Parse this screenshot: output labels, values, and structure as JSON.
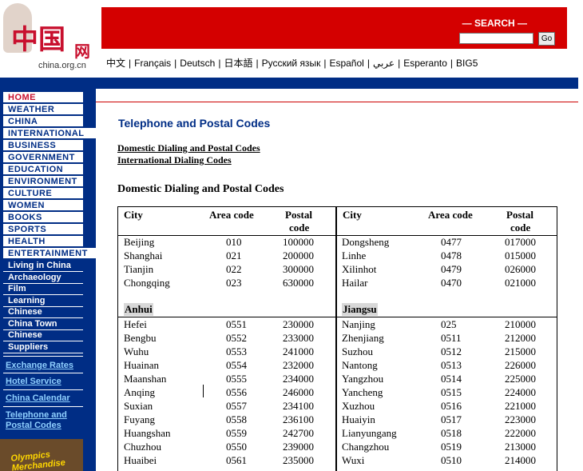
{
  "header": {
    "logo_chars": "中国",
    "logo_net": "网",
    "logo_domain": "china.org.cn",
    "search_label": "— SEARCH —",
    "search_button": "Go",
    "languages": [
      "中文",
      "Français",
      "Deutsch",
      "日本語",
      "Русский язык",
      "Español",
      "عربي",
      "Esperanto",
      "BIG5"
    ]
  },
  "nav": {
    "top_items": [
      "HOME",
      "WEATHER",
      "CHINA",
      "INTERNATIONAL",
      "BUSINESS",
      "GOVERNMENT",
      "EDUCATION",
      "ENVIRONMENT",
      "CULTURE",
      "WOMEN",
      "BOOKS",
      "SPORTS",
      "HEALTH",
      "ENTERTAINMENT"
    ],
    "mid_items": [
      "Living in China",
      "Archaeology",
      "Film",
      "Learning",
      "Chinese",
      "China Town",
      "Chinese",
      "Suppliers"
    ],
    "links": [
      "Exchange Rates",
      "Hotel Service",
      "China Calendar",
      "Telephone and",
      "Postal Codes"
    ],
    "banner": "Olympics Merchandise"
  },
  "main": {
    "title": "Telephone and Postal Codes",
    "toc": [
      "Domestic Dialing and Postal Codes",
      "International Dialing Codes"
    ],
    "section_heading": "Domestic Dialing and Postal Codes",
    "table": {
      "headers": {
        "city": "City",
        "area_code": "Area code",
        "postal_line1": "Postal",
        "postal_line2": "code"
      },
      "left": {
        "top_rows": [
          [
            "Beijing",
            "010",
            "100000"
          ],
          [
            "Shanghai",
            "021",
            "200000"
          ],
          [
            "Tianjin",
            "022",
            "300000"
          ],
          [
            "Chongqing",
            "023",
            "630000"
          ]
        ],
        "province": "Anhui",
        "rows": [
          [
            "Hefei",
            "0551",
            "230000"
          ],
          [
            "Bengbu",
            "0552",
            "233000"
          ],
          [
            "Wuhu",
            "0553",
            "241000"
          ],
          [
            "Huainan",
            "0554",
            "232000"
          ],
          [
            "Maanshan",
            "0555",
            "234000"
          ],
          [
            "Anqing",
            "0556",
            "246000"
          ],
          [
            "Suxian",
            "0557",
            "234100"
          ],
          [
            "Fuyang",
            "0558",
            "236100"
          ],
          [
            "Huangshan",
            "0559",
            "242700"
          ],
          [
            "Chuzhou",
            "0550",
            "239000"
          ],
          [
            "Huaibei",
            "0561",
            "235000"
          ]
        ]
      },
      "right": {
        "top_rows": [
          [
            "Dongsheng",
            "0477",
            "017000"
          ],
          [
            "Linhe",
            "0478",
            "015000"
          ],
          [
            "Xilinhot",
            "0479",
            "026000"
          ],
          [
            "Hailar",
            "0470",
            "021000"
          ]
        ],
        "province": "Jiangsu",
        "rows": [
          [
            "Nanjing",
            "025",
            "210000"
          ],
          [
            "Zhenjiang",
            "0511",
            "212000"
          ],
          [
            "Suzhou",
            "0512",
            "215000"
          ],
          [
            "Nantong",
            "0513",
            "226000"
          ],
          [
            "Yangzhou",
            "0514",
            "225000"
          ],
          [
            "Yancheng",
            "0515",
            "224000"
          ],
          [
            "Xuzhou",
            "0516",
            "221000"
          ],
          [
            "Huaiyin",
            "0517",
            "223000"
          ],
          [
            "Lianyungang",
            "0518",
            "222000"
          ],
          [
            "Changzhou",
            "0519",
            "213000"
          ],
          [
            "Wuxi",
            "0510",
            "214000"
          ]
        ]
      }
    }
  },
  "colors": {
    "brand_red": "#d40000",
    "nav_blue": "#002d85",
    "title_blue": "#002d85",
    "link_cyan": "#8fd0ff"
  }
}
